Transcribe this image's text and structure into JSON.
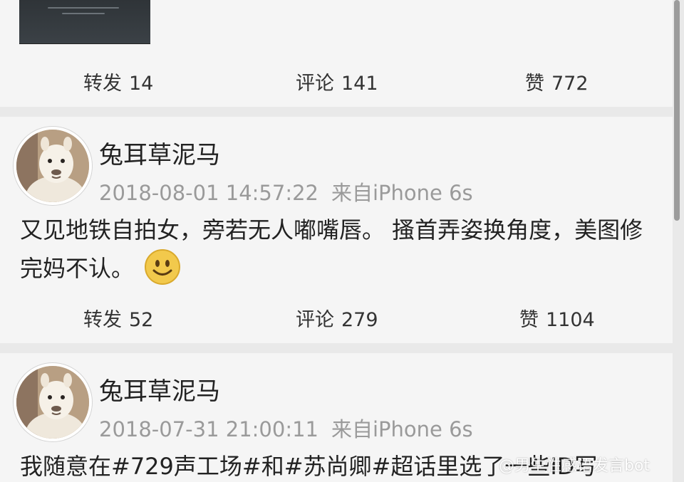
{
  "posts": [
    {
      "actions": {
        "repost_label": "转发",
        "repost_count": "14",
        "comment_label": "评论",
        "comment_count": "141",
        "like_label": "赞",
        "like_count": "772"
      }
    },
    {
      "username": "兔耳草泥马",
      "timestamp": "2018-08-01 14:57:22",
      "source": "来自iPhone 6s",
      "text": "又见地铁自拍女，旁若无人嘟嘴唇。 搔首弄姿换角度，美图修完妈不认。",
      "emoji": "smiley-emoji",
      "actions": {
        "repost_label": "转发",
        "repost_count": "52",
        "comment_label": "评论",
        "comment_count": "279",
        "like_label": "赞",
        "like_count": "1104"
      }
    },
    {
      "username": "兔耳草泥马",
      "timestamp": "2018-07-31 21:00:11",
      "source": "来自iPhone 6s",
      "text": "我随意在#729声工场#和#苏尚卿#超话里选了一些ID写"
    }
  ],
  "watermark": "@男生性感语发言bot",
  "colors": {
    "background": "#e9e9e9",
    "card": "#f5f5f5",
    "text": "#222222",
    "meta": "#9a9a9a",
    "smiley": "#f2c94c"
  }
}
